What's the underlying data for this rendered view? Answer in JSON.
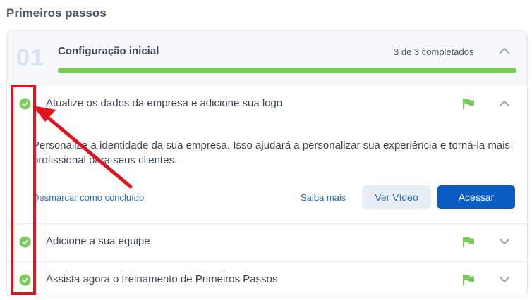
{
  "page": {
    "heading": "Primeiros passos"
  },
  "section": {
    "number": "01",
    "title": "Configuração inicial",
    "progress_text": "3 de 3 completados",
    "progress_fraction": 1.0
  },
  "tasks": [
    {
      "label": "Atualize os dados da empresa e adicione sua logo",
      "completed": true,
      "expanded": true,
      "description": "Personalize a identidade da sua empresa. Isso ajudará a personalizar sua experiência e torná-la mais profissional para seus clientes.",
      "unmark_label": "Desmarcar como concluído",
      "learn_more_label": "Saiba mais",
      "video_label": "Ver Vídeo",
      "access_label": "Acessar"
    },
    {
      "label": "Adicione a sua equipe",
      "completed": true,
      "expanded": false
    },
    {
      "label": "Assista agora o treinamento de Primeiros Passos",
      "completed": true,
      "expanded": false
    }
  ],
  "icons": {
    "check": "check-circle-icon",
    "flag": "flag-icon",
    "chevron_up": "chevron-up-icon",
    "chevron_down": "chevron-down-icon"
  },
  "colors": {
    "primary": "#0b5cc5",
    "success": "#7bcb5b",
    "link": "#2b6cb0",
    "annotation": "#e0141d"
  }
}
